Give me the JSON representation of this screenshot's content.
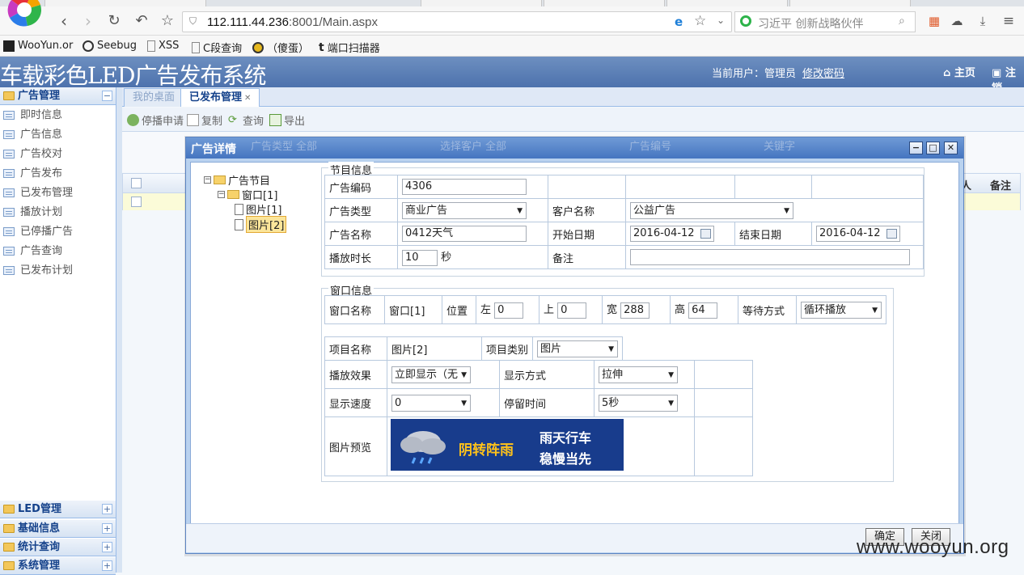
{
  "browser": {
    "address_host": "112.111.44.236",
    "address_rest": ":8001/Main.aspx",
    "search_placeholder": "习近平 创新战略伙伴",
    "bookmarks": [
      "WooYun.or",
      "Seebug",
      "XSS",
      "C段查询",
      "（傻蛋）",
      "端口扫描器"
    ]
  },
  "header": {
    "title": "车载彩色LED广告发布系统",
    "user_label": "当前用户：管理员",
    "change_password": "修改密码",
    "home": "主页",
    "logout": "注销"
  },
  "sidebar": {
    "group_ad": "广告管理",
    "items": [
      "即时信息",
      "广告信息",
      "广告校对",
      "广告发布",
      "已发布管理",
      "播放计划",
      "已停播广告",
      "广告查询",
      "已发布计划"
    ],
    "group_led": "LED管理",
    "group_basic": "基础信息",
    "group_stats": "统计查询",
    "group_system": "系统管理"
  },
  "main": {
    "tab_desktop": "我的桌面",
    "tab_published": "已发布管理",
    "toolbar": [
      "停播申请",
      "复制",
      "查询",
      "导出"
    ],
    "filter_partial": [
      "广告类型",
      "全部",
      "选择客户",
      "全部",
      "广告编号",
      "关键字"
    ],
    "grid_headers": [
      "人",
      "备注"
    ]
  },
  "modal": {
    "title": "广告详情",
    "tree": {
      "root": "广告节目",
      "window": "窗口[1]",
      "pic1": "图片[1]",
      "pic2": "图片[2]"
    },
    "program": {
      "legend": "节目信息",
      "ad_code_label": "广告编码",
      "ad_code": "4306",
      "ad_type_label": "广告类型",
      "ad_type": "商业广告",
      "customer_label": "客户名称",
      "customer": "公益广告",
      "ad_name_label": "广告名称",
      "ad_name": "0412天气",
      "start_label": "开始日期",
      "start": "2016-04-12",
      "end_label": "结束日期",
      "end": "2016-04-12",
      "duration_label": "播放时长",
      "duration": "10",
      "seconds": "秒",
      "remark_label": "备注",
      "remark": ""
    },
    "window": {
      "legend": "窗口信息",
      "name_label": "窗口名称",
      "name": "窗口[1]",
      "pos_label": "位置",
      "left_label": "左",
      "left": "0",
      "top_label": "上",
      "top": "0",
      "width_label": "宽",
      "width": "288",
      "height_label": "高",
      "height": "64",
      "wait_label": "等待方式",
      "wait": "循环播放"
    },
    "item": {
      "name_label": "项目名称",
      "name": "图片[2]",
      "type_label": "项目类别",
      "type": "图片",
      "effect_label": "播放效果",
      "effect": "立即显示（无",
      "display_label": "显示方式",
      "display": "拉伸",
      "speed_label": "显示速度",
      "speed": "0",
      "stay_label": "停留时间",
      "stay": "5秒",
      "preview_label": "图片预览",
      "preview_text1": "阴转阵雨",
      "preview_text2": "雨天行车",
      "preview_text3": "稳慢当先"
    },
    "ok": "确定",
    "close": "关闭"
  },
  "watermark": "www.wooyun.org"
}
